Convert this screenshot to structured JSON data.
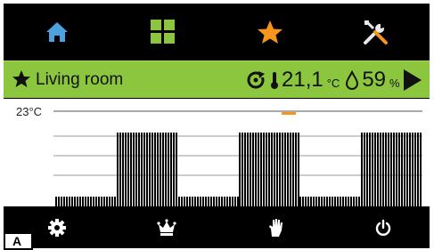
{
  "topnav": {
    "items": [
      {
        "icon": "home-icon",
        "color": "#4aa3df"
      },
      {
        "icon": "grid-icon",
        "color": "#8cc63f"
      },
      {
        "icon": "star-icon",
        "color": "#f7941d"
      },
      {
        "icon": "tools-icon",
        "color": "#e6e6e6"
      }
    ]
  },
  "header": {
    "room_name": "Living room",
    "temperature": "21,1",
    "temperature_unit": "°C",
    "humidity": "59",
    "humidity_unit": "%",
    "background": "#8cc63f"
  },
  "chart": {
    "axis_label": "23°C",
    "marker_color": "#f7941d"
  },
  "bottomnav": {
    "items": [
      "gear-icon",
      "crown-icon",
      "hand-icon",
      "power-icon"
    ]
  },
  "figure_label": "A"
}
